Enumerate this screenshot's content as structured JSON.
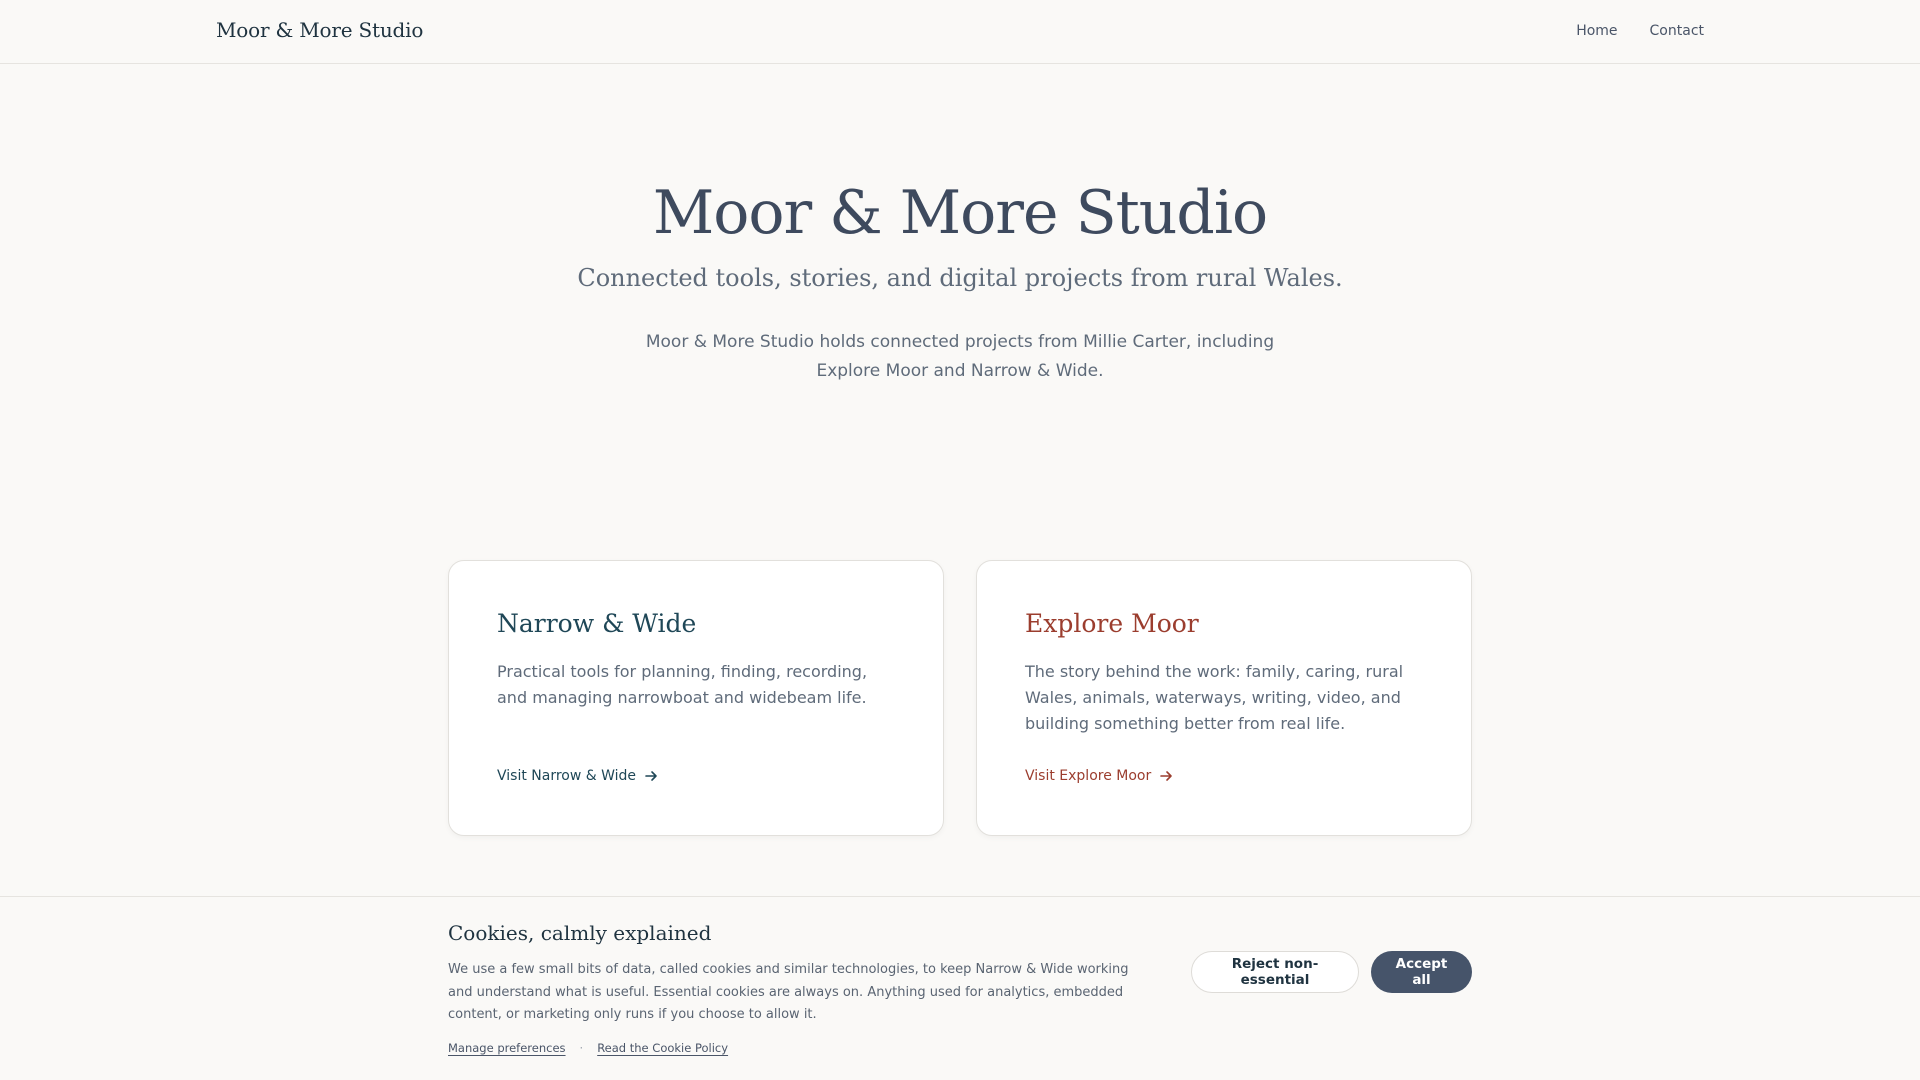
{
  "header": {
    "brand": "Moor & More Studio",
    "nav": [
      "Home",
      "Contact"
    ]
  },
  "hero": {
    "title": "Moor & More Studio",
    "subtitle": "Connected tools, stories, and digital projects from rural Wales.",
    "intro": "Moor & More Studio holds connected projects from Millie Carter, including Explore Moor and Narrow & Wide."
  },
  "cards": [
    {
      "title": "Narrow & Wide",
      "description": "Practical tools for planning, finding, recording, and managing narrowboat and widebeam life.",
      "link_label": "Visit Narrow & Wide",
      "accent": "#1f4757"
    },
    {
      "title": "Explore Moor",
      "description": "The story behind the work: family, caring, rural Wales, animals, waterways, writing, video, and building something better from real life.",
      "link_label": "Visit Explore Moor",
      "accent": "#9b3d2e"
    }
  ],
  "cookie": {
    "title": "Cookies, calmly explained",
    "description": "We use a few small bits of data, called cookies and similar technologies, to keep Narrow & Wide working and understand what is useful. Essential cookies are always on. Anything used for analytics, embedded content, or marketing only runs if you choose to allow it.",
    "manage_label": "Manage preferences",
    "policy_label": "Read the Cookie Policy",
    "separator": "·",
    "reject_label": "Reject non-essential",
    "accept_label": "Accept all"
  },
  "colors": {
    "background": "#faf9f7",
    "primary_button": "#46546a",
    "text": "#3e4a5e"
  }
}
